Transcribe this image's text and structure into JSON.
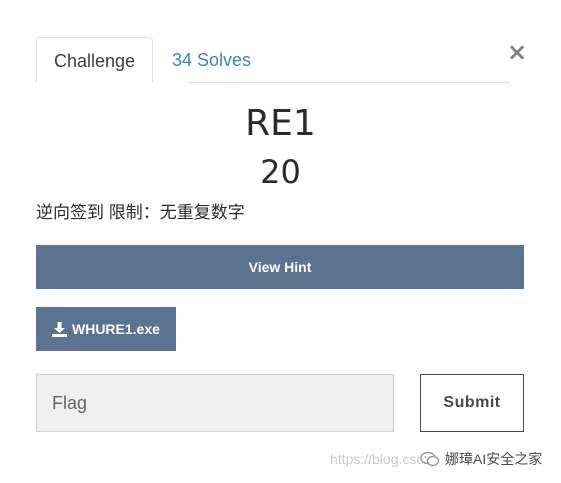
{
  "tabs": {
    "challenge": "Challenge",
    "solves": "34 Solves"
  },
  "close_glyph": "×",
  "challenge": {
    "name": "RE1",
    "points": "20",
    "description": "逆向签到 限制：无重复数字"
  },
  "hint_button": "View Hint",
  "file": {
    "label": "WHURE1.exe",
    "icon": "download-icon"
  },
  "flag_input": {
    "placeholder": "Flag",
    "value": ""
  },
  "submit_label": "Submit",
  "watermark": {
    "url": "https://blog.csdn.net/...",
    "brand": "娜璋AI安全之家",
    "icon": "wechat-icon"
  },
  "colors": {
    "button_bg": "#5b7290",
    "tab_link": "#3c83b9"
  }
}
